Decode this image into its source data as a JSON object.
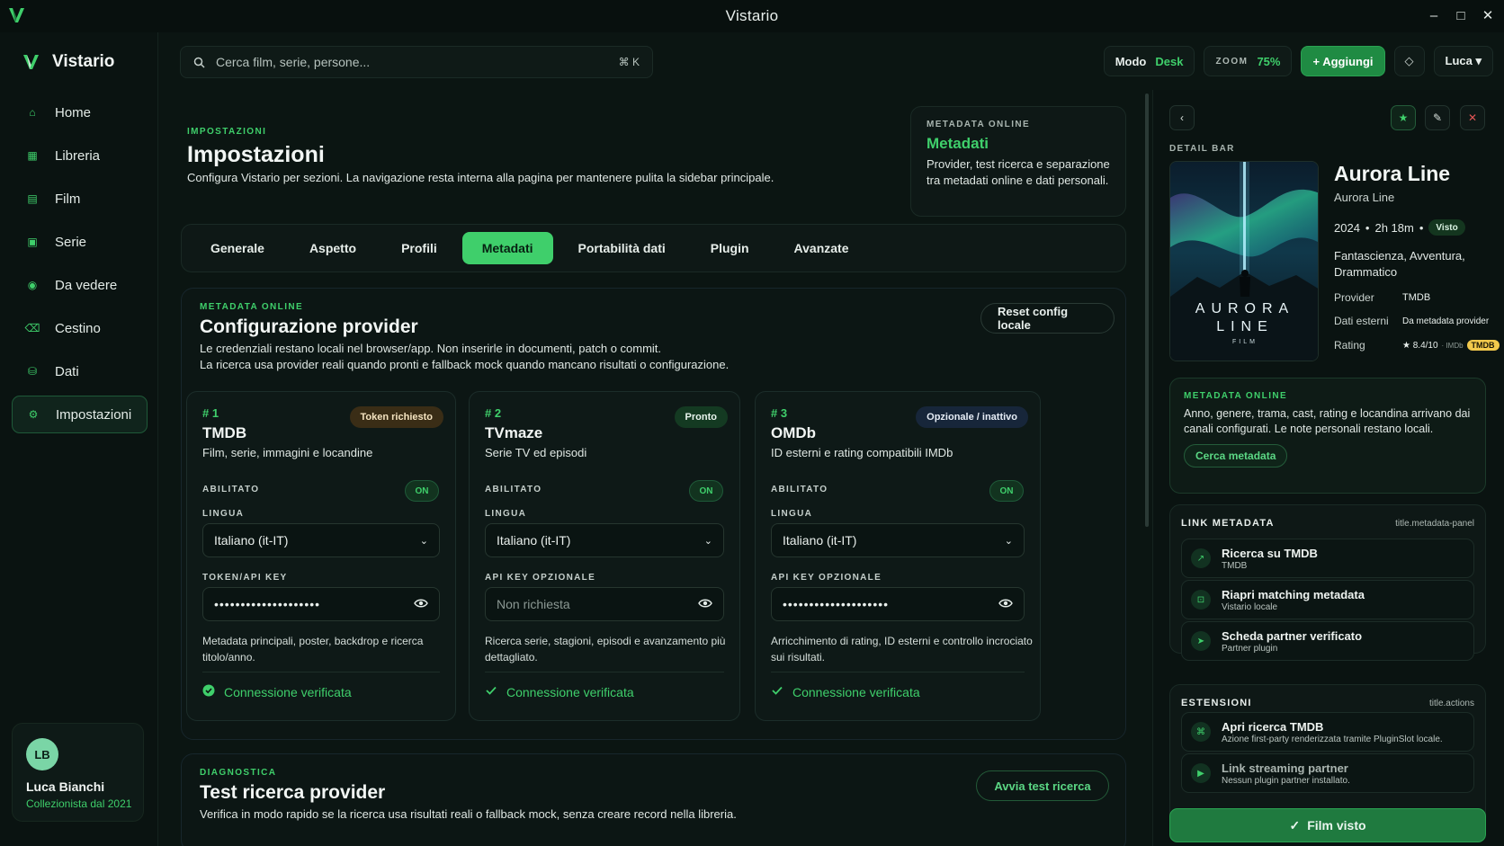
{
  "window": {
    "title": "Vistario"
  },
  "brand": {
    "name": "Vistario"
  },
  "nav": [
    {
      "label": "Home",
      "icon": "home-icon",
      "glyph": "⌂"
    },
    {
      "label": "Libreria",
      "icon": "library-icon",
      "glyph": "▦"
    },
    {
      "label": "Film",
      "icon": "film-icon",
      "glyph": "▤"
    },
    {
      "label": "Serie",
      "icon": "series-icon",
      "glyph": "▣"
    },
    {
      "label": "Da vedere",
      "icon": "watchlist-icon",
      "glyph": "◉"
    },
    {
      "label": "Cestino",
      "icon": "trash-icon",
      "glyph": "⌫"
    },
    {
      "label": "Dati",
      "icon": "data-icon",
      "glyph": "⛁"
    },
    {
      "label": "Impostazioni",
      "icon": "settings-icon",
      "glyph": "⚙"
    }
  ],
  "user": {
    "initials": "LB",
    "name": "Luca Bianchi",
    "subtitle": "Collezionista dal 2021"
  },
  "search": {
    "placeholder": "Cerca film, serie, persone...",
    "shortcut": "⌘ K"
  },
  "topbar": {
    "mode_label": "Modo",
    "mode_value": "Desk",
    "zoom_label": "ZOOM",
    "zoom_value": "75%",
    "add_label": "+ Aggiungi",
    "user_menu": "Luca ▾"
  },
  "page": {
    "eyebrow": "IMPOSTAZIONI",
    "title": "Impostazioni",
    "description": "Configura Vistario per sezioni. La navigazione resta interna alla pagina per mantenere pulita la sidebar principale."
  },
  "meta_card": {
    "eyebrow": "METADATA ONLINE",
    "title": "Metadati",
    "text": "Provider, test ricerca e separazione tra metadati online e dati personali."
  },
  "tabs": [
    "Generale",
    "Aspetto",
    "Profili",
    "Metadati",
    "Portabilità dati",
    "Plugin",
    "Avanzate"
  ],
  "active_tab": "Metadati",
  "provider_section": {
    "eyebrow": "METADATA ONLINE",
    "title": "Configurazione provider",
    "desc_line1": "Le credenziali restano locali nel browser/app. Non inserirle in documenti, patch o commit.",
    "desc_line2": "La ricerca usa provider reali quando pronti e fallback mock quando mancano risultati o configurazione.",
    "reset_label": "Reset config locale",
    "enabled_label": "ABILITATO",
    "language_label": "LINGUA",
    "toggle_on": "ON",
    "verified_label": "Connessione verificata"
  },
  "providers": [
    {
      "num": "# 1",
      "name": "TMDB",
      "subtitle": "Film, serie, immagini e locandine",
      "badge": "Token richiesto",
      "language": "Italiano (it-IT)",
      "key_label": "TOKEN/API KEY",
      "key_value": "••••••••••••••••••••",
      "key_placeholder": "",
      "desc_line1": "Metadata principali, poster, backdrop e ricerca",
      "desc_line2": "titolo/anno."
    },
    {
      "num": "# 2",
      "name": "TVmaze",
      "subtitle": "Serie TV ed episodi",
      "badge": "Pronto",
      "language": "Italiano (it-IT)",
      "key_label": "API KEY OPZIONALE",
      "key_value": "",
      "key_placeholder": "Non richiesta",
      "desc_line1": "Ricerca serie, stagioni, episodi e avanzamento più",
      "desc_line2": "dettagliato."
    },
    {
      "num": "# 3",
      "name": "OMDb",
      "subtitle": "ID esterni e rating compatibili IMDb",
      "badge": "Opzionale / inattivo",
      "language": "Italiano (it-IT)",
      "key_label": "API KEY OPZIONALE",
      "key_value": "••••••••••••••••••••",
      "key_placeholder": "",
      "desc_line1": "Arricchimento di rating, ID esterni e controllo incrociato",
      "desc_line2": "sui risultati."
    }
  ],
  "diagnostics": {
    "eyebrow": "DIAGNOSTICA",
    "title": "Test ricerca provider",
    "description": "Verifica in modo rapido se la ricerca usa risultati reali o fallback mock, senza creare record nella libreria.",
    "button": "Avvia test ricerca"
  },
  "detail": {
    "label": "DETAIL BAR",
    "title": "Aurora Line",
    "original_title": "Aurora Line",
    "year": "2024",
    "runtime": "2h 18m",
    "status": "Visto",
    "genres": "Fantascienza, Avventura, Drammatico",
    "poster_line1": "AURORA",
    "poster_line2": "LINE",
    "poster_sub": "FILM",
    "provider_label": "Provider",
    "provider_value": "TMDB",
    "external_label": "Dati esterni",
    "external_value": "Da metadata provider",
    "rating_label": "Rating",
    "rating_value": "★ 8.4/10",
    "rating_imdb": "· IMDb",
    "rating_tag": "TMDB",
    "online": {
      "eyebrow": "METADATA ONLINE",
      "text": "Anno, genere, trama, cast, rating e locandina arrivano dai canali configurati. Le note personali restano locali.",
      "button": "Cerca metadata"
    },
    "links": {
      "title": "LINK METADATA",
      "tag": "title.metadata-panel",
      "items": [
        {
          "title": "Ricerca su TMDB",
          "sub": "TMDB",
          "glyph": "↗"
        },
        {
          "title": "Riapri matching metadata",
          "sub": "Vistario locale",
          "glyph": "⊡"
        },
        {
          "title": "Scheda partner verificato",
          "sub": "Partner plugin",
          "glyph": "➤"
        }
      ]
    },
    "extensions": {
      "title": "ESTENSIONI",
      "tag": "title.actions",
      "items": [
        {
          "title": "Apri ricerca TMDB",
          "sub": "Azione first-party renderizzata tramite PluginSlot locale.",
          "glyph": "⌘"
        },
        {
          "title": "Link streaming partner",
          "sub": "Nessun plugin partner installato.",
          "glyph": "▶"
        }
      ]
    },
    "watched_button": "Film visto"
  },
  "colors": {
    "accent": "#3fcf6b",
    "background": "#0b1512",
    "surface": "#0e1816",
    "warning_badge": "#3a2d16",
    "tmdb_yellow": "#f2c94c"
  }
}
